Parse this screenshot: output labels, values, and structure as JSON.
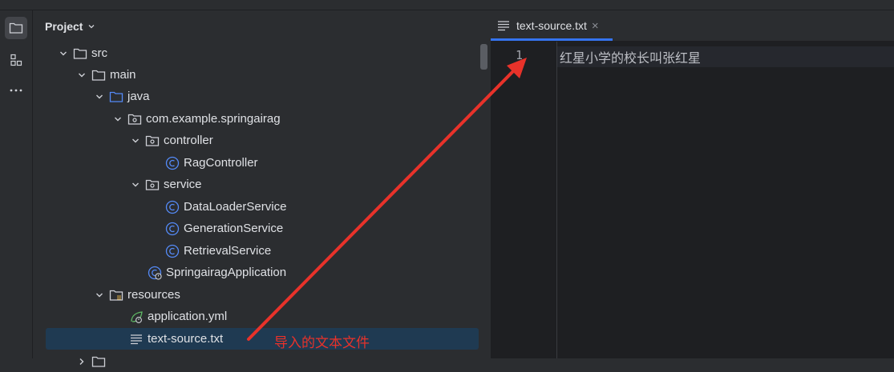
{
  "project_panel": {
    "title": "Project"
  },
  "tree": {
    "src": "src",
    "main": "main",
    "java": "java",
    "package": "com.example.springairag",
    "controller": "controller",
    "rag_controller": "RagController",
    "service": "service",
    "data_loader": "DataLoaderService",
    "generation": "GenerationService",
    "retrieval": "RetrievalService",
    "application": "SpringairagApplication",
    "resources": "resources",
    "application_yml": "application.yml",
    "text_source": "text-source.txt"
  },
  "editor": {
    "tab_label": "text-source.txt",
    "tab_close": "×",
    "line_number": "1",
    "line_text": "红星小学的校长叫张红星"
  },
  "annotation": {
    "text": "导入的文本文件"
  },
  "colors": {
    "folder": "#a9b7c6",
    "java_folder": "#548af7",
    "class_icon": "#548af7",
    "annotation": "#e8322a",
    "selection": "#1f3a52"
  },
  "icons": {
    "folder": "folder-icon",
    "package": "package-icon",
    "class": "class-icon",
    "spring": "spring-leaf-icon",
    "text_file": "text-file-icon"
  }
}
